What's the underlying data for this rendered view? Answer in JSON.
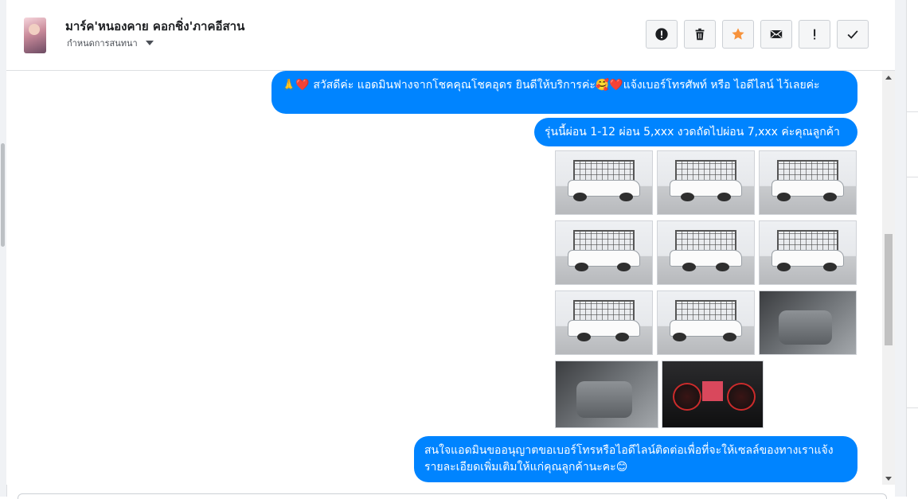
{
  "conversation": {
    "contact_name": "มาร์ค'หนองคาย คอกชิ่ง'ภาคอีสาน",
    "status_label": "กำหนดการสนทนา"
  },
  "toolbar": {
    "buttons": [
      {
        "id": "report",
        "icon": "alert-circle-icon"
      },
      {
        "id": "delete",
        "icon": "trash-icon"
      },
      {
        "id": "star",
        "icon": "star-icon",
        "color": "#f7923b"
      },
      {
        "id": "mail",
        "icon": "envelope-icon"
      },
      {
        "id": "mark-important",
        "icon": "exclamation-icon"
      },
      {
        "id": "done",
        "icon": "checkmark-icon"
      }
    ]
  },
  "messages": [
    {
      "text": "🙏❤️ สวัสดีค่ะ แอดมินฟางจากโชคคุณโชคอุดร ยินดีให้บริการค่ะ🥰❤️แจ้งเบอร์โทรศัพท์ หรือ ไอดีไลน์ ไว้เลยค่ะ"
    },
    {
      "text": "รุ่นนี้ผ่อน 1-12 ผ่อน 5,xxx งวดถัดไปผ่อน 7,xxx ค่ะคุณลูกค้า"
    },
    {
      "text": "สนใจแอดมินขออนุญาตขอเบอร์โทรหรือไอดีไลน์ติดต่อเพื่อที่จะให้เซลล์ของทางเราแจ้งรายละเอียดเพิ่มเติมให้แก่คุณลูกค้านะคะ😊"
    }
  ],
  "photos": [
    {
      "kind": "truck-front-left"
    },
    {
      "kind": "truck-front"
    },
    {
      "kind": "truck-side-right"
    },
    {
      "kind": "truck-front-left"
    },
    {
      "kind": "truck-rear"
    },
    {
      "kind": "truck-rear-right"
    },
    {
      "kind": "truck-rear-left"
    },
    {
      "kind": "truck-side-left"
    },
    {
      "kind": "interior-driver"
    },
    {
      "kind": "interior-passenger"
    },
    {
      "kind": "dashboard-gauges"
    }
  ],
  "colors": {
    "bubble": "#0084ff",
    "star": "#f7923b"
  }
}
